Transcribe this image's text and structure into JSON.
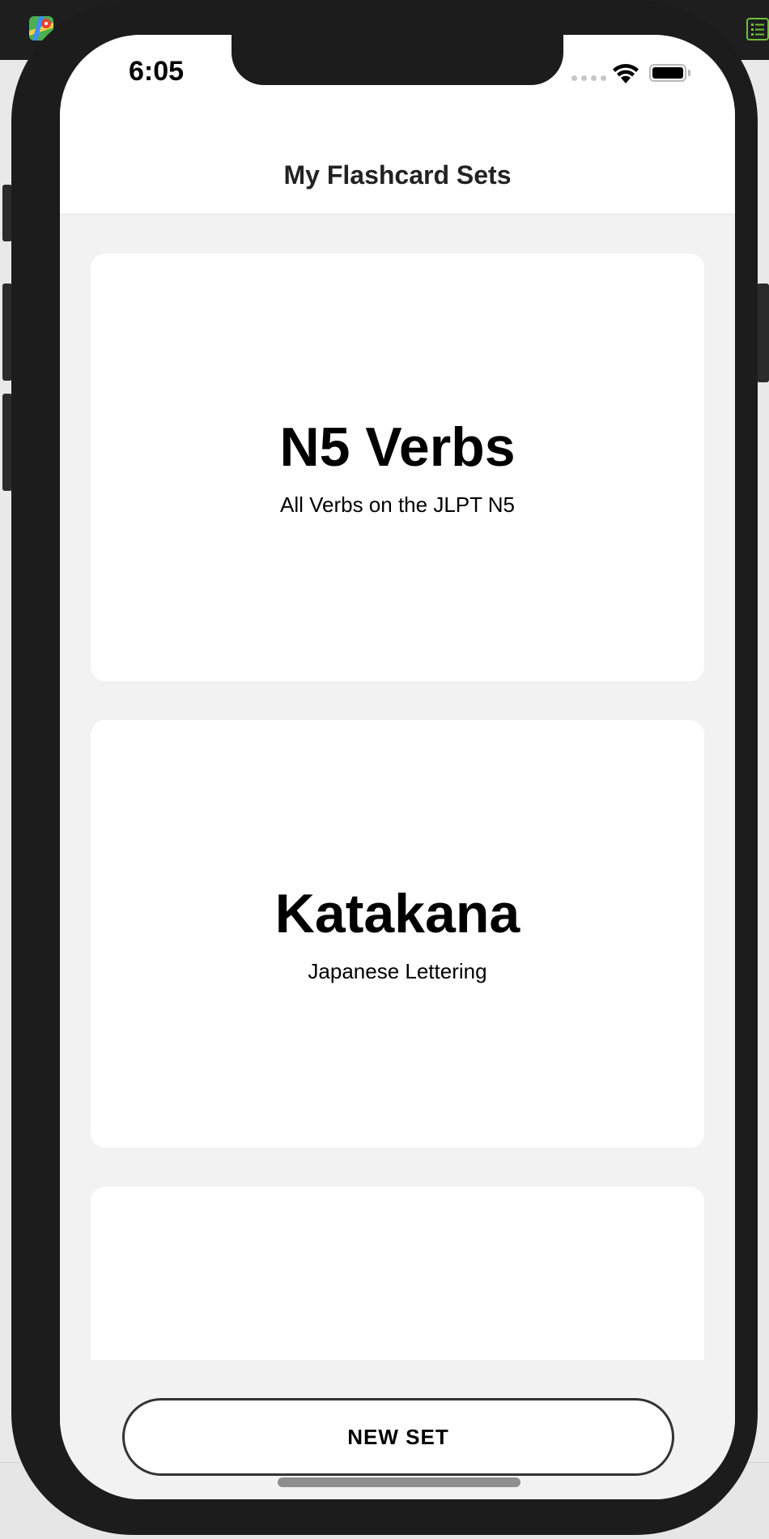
{
  "status_bar": {
    "time": "6:05"
  },
  "nav": {
    "title": "My Flashcard Sets"
  },
  "cards": [
    {
      "title": "N5 Verbs",
      "subtitle": "All Verbs on the JLPT N5"
    },
    {
      "title": "Katakana",
      "subtitle": "Japanese Lettering"
    },
    {
      "title": "",
      "subtitle": ""
    }
  ],
  "actions": {
    "new_set_label": "NEW SET"
  },
  "colors": {
    "phone_frame": "#1c1c1c",
    "screen_background": "#f2f2f2",
    "card_background": "#ffffff",
    "button_border": "#333333"
  },
  "icons": [
    "maps-app-icon",
    "list-app-icon",
    "wifi-icon",
    "battery-icon",
    "cellular-signal-icon"
  ]
}
